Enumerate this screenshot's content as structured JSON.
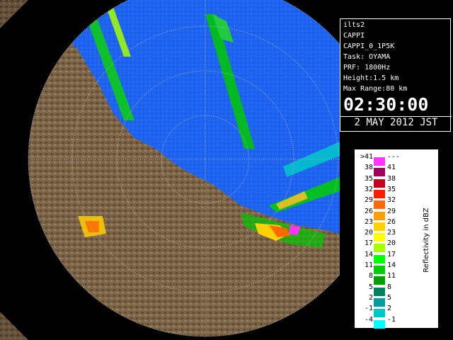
{
  "info": {
    "lines": [
      "ilts2",
      "CAPPI",
      "CAPPI_0_1P5K",
      "Task: OYAMA",
      "PRF: 1800Hz",
      "Height:1.5 km",
      "Max Range:80 km"
    ],
    "time": "02:30:00",
    "date": "2 MAY 2012 JST"
  },
  "legend": {
    "unit_label": "Reflectivity in dBZ",
    "levels": [
      {
        "left": ">41",
        "right": "---",
        "color": "#ff33ff"
      },
      {
        "left": "38",
        "right": "41",
        "color": "#a0005a"
      },
      {
        "left": "35",
        "right": "38",
        "color": "#c8001e"
      },
      {
        "left": "32",
        "right": "35",
        "color": "#ff1a00"
      },
      {
        "left": "29",
        "right": "32",
        "color": "#ff6a00"
      },
      {
        "left": "26",
        "right": "29",
        "color": "#ffa000"
      },
      {
        "left": "23",
        "right": "26",
        "color": "#ffd000"
      },
      {
        "left": "20",
        "right": "23",
        "color": "#ffff00"
      },
      {
        "left": "17",
        "right": "20",
        "color": "#a8ff00"
      },
      {
        "left": "14",
        "right": "17",
        "color": "#00ff00"
      },
      {
        "left": "11",
        "right": "14",
        "color": "#00d000"
      },
      {
        "left": "8",
        "right": "11",
        "color": "#00a000"
      },
      {
        "left": "5",
        "right": "8",
        "color": "#008060"
      },
      {
        "left": "2",
        "right": "5",
        "color": "#00a0a0"
      },
      {
        "left": "-1",
        "right": "2",
        "color": "#00c8c8"
      },
      {
        "left": "-4",
        "right": "-1",
        "color": "#00ffff"
      }
    ]
  },
  "map": {
    "sea_color": "#1e64f0",
    "land_color": "#7a6248",
    "circle_color": "#b4b4b4"
  }
}
